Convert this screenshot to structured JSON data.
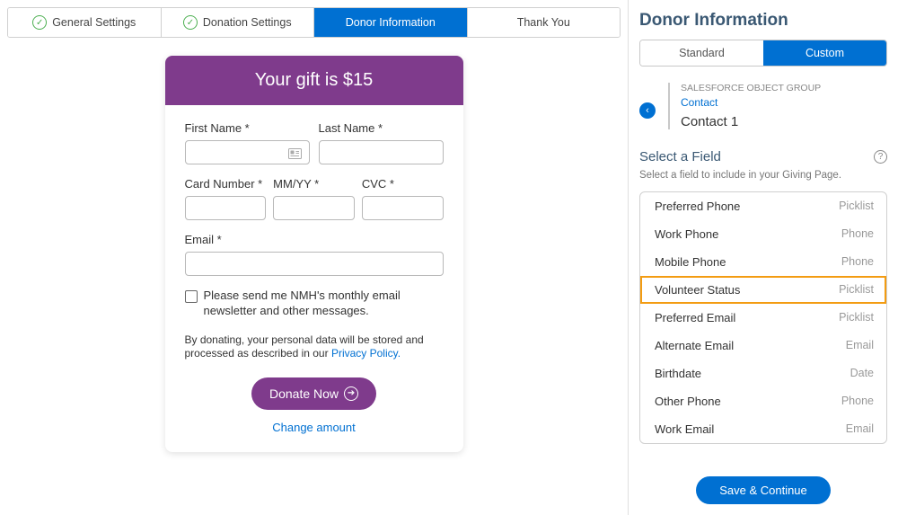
{
  "tabs": [
    {
      "label": "General Settings",
      "checked": true,
      "active": false
    },
    {
      "label": "Donation Settings",
      "checked": true,
      "active": false
    },
    {
      "label": "Donor Information",
      "checked": false,
      "active": true
    },
    {
      "label": "Thank You",
      "checked": false,
      "active": false
    }
  ],
  "form": {
    "header": "Your gift is $15",
    "firstNameLabel": "First Name *",
    "lastNameLabel": "Last Name *",
    "cardNumberLabel": "Card Number *",
    "mmYYLabel": "MM/YY *",
    "cvcLabel": "CVC *",
    "emailLabel": "Email *",
    "checkboxText": "Please send me NMH's monthly email newsletter and other messages.",
    "privacyPrefix": "By donating, your personal data will be stored and processed as described in our ",
    "privacyLink": "Privacy Policy.",
    "donateBtn": "Donate Now",
    "changeAmount": "Change amount"
  },
  "right": {
    "title": "Donor Information",
    "toggle": {
      "standard": "Standard",
      "custom": "Custom"
    },
    "breadcrumb": {
      "groupLabel": "SALESFORCE OBJECT GROUP",
      "link": "Contact",
      "current": "Contact 1"
    },
    "selectField": {
      "title": "Select a Field",
      "subtext": "Select a field to include in your Giving Page."
    },
    "fields": [
      {
        "name": "Preferred Phone",
        "type": "Picklist",
        "highlighted": false
      },
      {
        "name": "Work Phone",
        "type": "Phone",
        "highlighted": false
      },
      {
        "name": "Mobile Phone",
        "type": "Phone",
        "highlighted": false
      },
      {
        "name": "Volunteer Status",
        "type": "Picklist",
        "highlighted": true
      },
      {
        "name": "Preferred Email",
        "type": "Picklist",
        "highlighted": false
      },
      {
        "name": "Alternate Email",
        "type": "Email",
        "highlighted": false
      },
      {
        "name": "Birthdate",
        "type": "Date",
        "highlighted": false
      },
      {
        "name": "Other Phone",
        "type": "Phone",
        "highlighted": false
      },
      {
        "name": "Work Email",
        "type": "Email",
        "highlighted": false
      }
    ],
    "saveBtn": "Save & Continue"
  }
}
